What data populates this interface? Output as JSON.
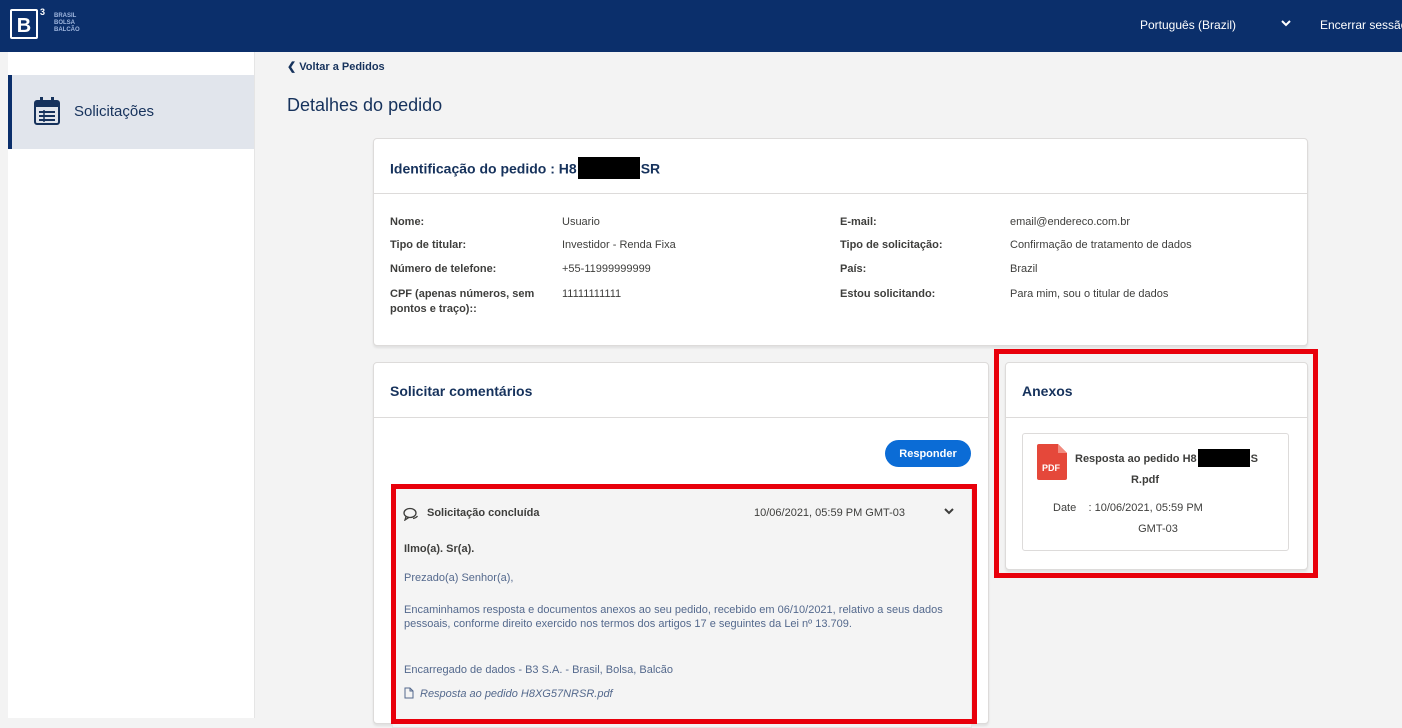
{
  "header": {
    "logo_letter": "B",
    "logo_superscript": "3",
    "logo_words": [
      "BRASIL",
      "BOLSA",
      "BALCÃO"
    ],
    "language": "Português (Brazil)",
    "logout": "Encerrar sessão"
  },
  "sidebar": {
    "items": [
      {
        "label": "Solicitações",
        "icon": "calendar-icon"
      }
    ]
  },
  "back_link": "Voltar a Pedidos",
  "page_title": "Detalhes do pedido",
  "identification": {
    "title_prefix": "Identificação do pedido : H8",
    "title_suffix": "SR",
    "left_fields": [
      {
        "label": "Nome:",
        "value": "Usuario"
      },
      {
        "label": "Tipo de titular:",
        "value": "Investidor - Renda Fixa"
      },
      {
        "label": "Número de telefone:",
        "value": "+55-11999999999"
      },
      {
        "label": "CPF (apenas números, sem pontos e traço)::",
        "value": "11111111111"
      }
    ],
    "right_fields": [
      {
        "label": "E-mail:",
        "value": "email@endereco.com.br"
      },
      {
        "label": "Tipo de solicitação:",
        "value": "Confirmação de tratamento de dados"
      },
      {
        "label": "País:",
        "value": "Brazil"
      },
      {
        "label": "Estou solicitando:",
        "value": "Para mim, sou o titular de dados"
      }
    ]
  },
  "comments": {
    "title": "Solicitar comentários",
    "reply_button": "Responder",
    "message": {
      "title": "Solicitação concluída",
      "date": "10/06/2021, 05:59 PM GMT-03",
      "greeting": "Ilmo(a). Sr(a).",
      "salutation": "Prezado(a) Senhor(a),",
      "body": "Encaminhamos resposta e documentos anexos ao seu pedido, recebido em 06/10/2021, relativo a seus dados pessoais, conforme direito exercido nos termos dos artigos 17 e seguintes da Lei nº 13.709.",
      "signature": "Encarregado de dados - B3 S.A. - Brasil, Bolsa, Balcão",
      "attachment": "Resposta ao pedido H8XG57NRSR.pdf"
    }
  },
  "attachments": {
    "title": "Anexos",
    "file": {
      "icon_text": "PDF",
      "name_prefix": "Resposta ao pedido H8",
      "name_suffix": "S",
      "name_line2": "R.pdf",
      "date_label": "Date",
      "date_value": ": 10/06/2021, 05:59 PM",
      "date_tz": "GMT-03"
    }
  },
  "colors": {
    "brand_navy": "#0b2f6b",
    "button_blue": "#0b6cd6",
    "highlight_red": "#e8000b",
    "pdf_red": "#e5483a"
  }
}
